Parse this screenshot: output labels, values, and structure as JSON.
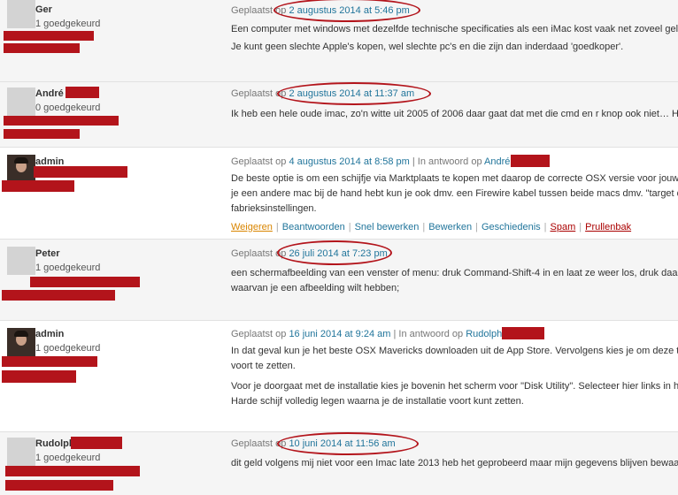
{
  "comments": [
    {
      "author": "Ger",
      "approved": "1 goedgekeurd",
      "posted_prefix": "Geplaatst op",
      "date": "2 augustus 2014 at 5:46 pm",
      "lines": [
        "Een computer met windows met dezelfde technische specificaties als een iMac kost vaak net zoveel geld",
        "Je kunt geen slechte Apple's kopen, wel slechte pc's en die zijn dan inderdaad 'goedkoper'."
      ]
    },
    {
      "author": "André",
      "approved": "0 goedgekeurd",
      "posted_prefix": "Geplaatst op",
      "date": "2 augustus 2014 at 11:37 am",
      "lines": [
        "Ik heb een hele oude imac, zo'n witte uit 2005 of 2006 daar gaat dat met die cmd en r knop ook niet… Ho"
      ]
    },
    {
      "author": "admin",
      "approved": "",
      "posted_prefix": "Geplaatst op",
      "date": "4 augustus 2014 at 8:58 pm",
      "reply_prefix": "| In antwoord op",
      "reply_to": "André",
      "lines": [
        "De beste optie is om een schijfje via Marktplaats te kopen met daarop de correcte OSX versie voor jouw i",
        "je een andere mac bij de hand hebt kun je ook dmv. een Firewire kabel tussen beide macs dmv. \"target d",
        "fabrieksinstellingen."
      ],
      "actions": {
        "reject": "Weigeren",
        "reply": "Beantwoorden",
        "quick_edit": "Snel bewerken",
        "edit": "Bewerken",
        "history": "Geschiedenis",
        "spam": "Spam",
        "trash": "Prullenbak"
      }
    },
    {
      "author": "Peter",
      "approved": "1 goedgekeurd",
      "posted_prefix": "Geplaatst op",
      "date": "26 juli 2014 at 7:23 pm",
      "lines": [
        "een schermafbeelding van een venster of menu: druk Command-Shift-4 in en laat ze weer los, druk daar",
        "waarvan je een afbeelding wilt hebben;"
      ]
    },
    {
      "author": "admin",
      "approved": "1 goedgekeurd",
      "posted_prefix": "Geplaatst op",
      "date": "16 juni 2014 at 9:24 am",
      "reply_prefix": "| In antwoord op",
      "reply_to": "Rudolph",
      "lines": [
        "In dat geval kun je het beste OSX Mavericks downloaden uit de App Store. Vervolgens kies je om deze te",
        "voort te zetten.",
        "Voor je doorgaat met de installatie kies je bovenin het scherm voor \"Disk Utility\". Selecteer hier links in h",
        "Harde schijf volledig legen waarna je de installatie voort kunt zetten."
      ]
    },
    {
      "author": "Rudolph",
      "approved": "1 goedgekeurd",
      "posted_prefix": "Geplaatst op",
      "date": "10 juni 2014 at 11:56 am",
      "lines": [
        "dit geld volgens mij niet voor een Imac late 2013 heb het geprobeerd maar mijn gegevens blijven bewaa"
      ]
    }
  ],
  "colors": {
    "link": "#21759b",
    "redaction": "#b3141b",
    "alt_row": "#f5f5f5",
    "reject": "#d98500",
    "danger": "#aa0000"
  }
}
